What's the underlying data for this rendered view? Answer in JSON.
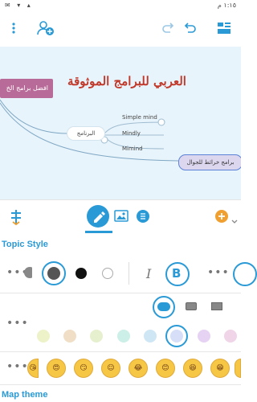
{
  "status": {
    "time": "١:١٥ م",
    "icons": "✉ ▾ ▴"
  },
  "toolbar": {},
  "canvas": {
    "title": "العربي للبرامج الموثوقة",
    "left_node": "افضل برامج الخ",
    "center_node": "البرنامج",
    "branches": [
      "Simple mind",
      "Mindly",
      "Mimind"
    ],
    "right_node": "برامج خرائط للجوال"
  },
  "tabs": {
    "active": "style"
  },
  "topic_style": {
    "title": "Topic Style",
    "italic_label": "I",
    "bold_label": "B"
  },
  "swatches": {
    "pastel": [
      "#eef2c8",
      "#f0dfc6",
      "#e6f0cf",
      "#ccefe8",
      "#cfe6f5",
      "#d6dff7",
      "#e6d2f2",
      "#f0d4e8",
      "#dcdcdc"
    ]
  },
  "map_theme": {
    "title": "Map theme"
  }
}
